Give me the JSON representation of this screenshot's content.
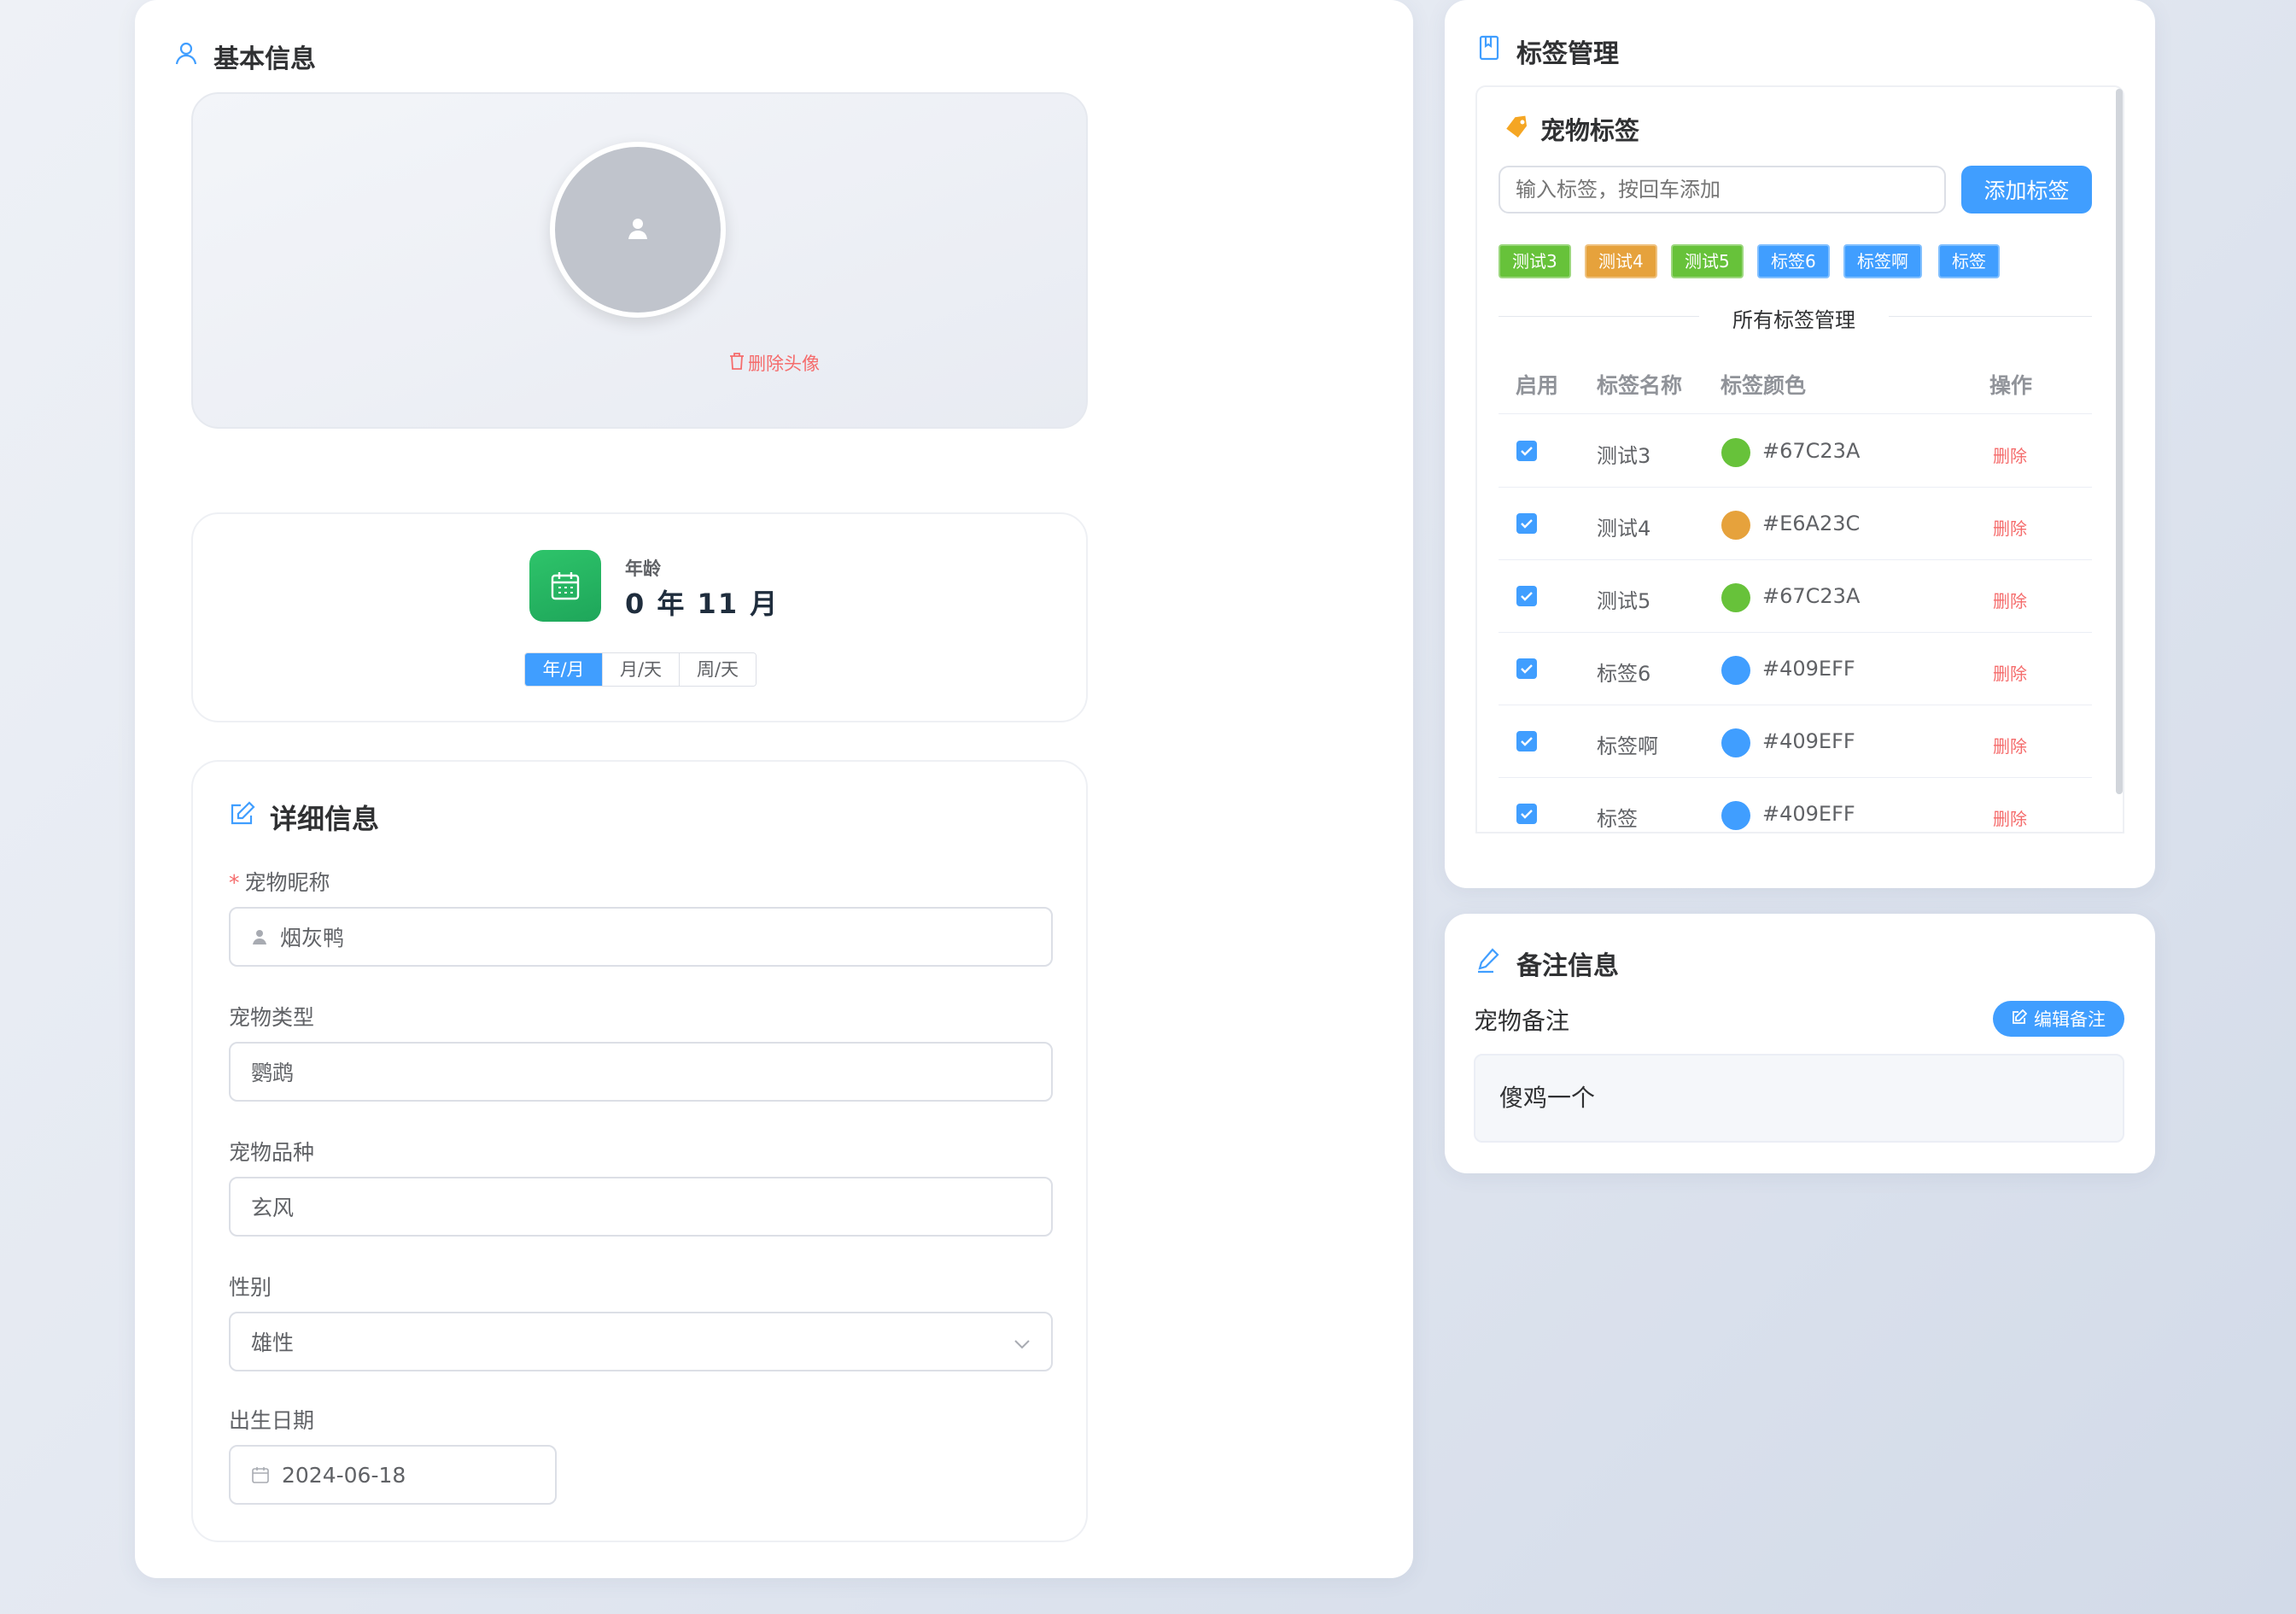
{
  "basic_info": {
    "title": "基本信息",
    "delete_avatar": "删除头像",
    "age": {
      "label": "年龄",
      "value": "0 年 11 月",
      "units": [
        "年/月",
        "月/天",
        "周/天"
      ],
      "selected": "年/月"
    }
  },
  "details": {
    "title": "详细信息",
    "nickname": {
      "label": "宠物昵称",
      "value": "烟灰鸭",
      "required": true
    },
    "type": {
      "label": "宠物类型",
      "value": "鹦鹉"
    },
    "breed": {
      "label": "宠物品种",
      "value": "玄风"
    },
    "gender": {
      "label": "性别",
      "value": "雄性"
    },
    "birthday": {
      "label": "出生日期",
      "value": "2024-06-18"
    }
  },
  "tags": {
    "title": "标签管理",
    "pet_tags_title": "宠物标签",
    "input_placeholder": "输入标签，按回车添加",
    "add_button": "添加标签",
    "chips": [
      {
        "label": "测试3",
        "color": "#67C23A"
      },
      {
        "label": "测试4",
        "color": "#E6A23C"
      },
      {
        "label": "测试5",
        "color": "#67C23A"
      },
      {
        "label": "标签6",
        "color": "#409EFF"
      },
      {
        "label": "标签啊",
        "color": "#409EFF"
      },
      {
        "label": "标签",
        "color": "#409EFF"
      }
    ],
    "all_tags_title": "所有标签管理",
    "columns": [
      "启用",
      "标签名称",
      "标签颜色",
      "操作"
    ],
    "rows": [
      {
        "name": "测试3",
        "color": "#67C23A",
        "enabled": true,
        "action": "删除"
      },
      {
        "name": "测试4",
        "color": "#E6A23C",
        "enabled": true,
        "action": "删除"
      },
      {
        "name": "测试5",
        "color": "#67C23A",
        "enabled": true,
        "action": "删除"
      },
      {
        "name": "标签6",
        "color": "#409EFF",
        "enabled": true,
        "action": "删除"
      },
      {
        "name": "标签啊",
        "color": "#409EFF",
        "enabled": true,
        "action": "删除"
      },
      {
        "name": "标签",
        "color": "#409EFF",
        "enabled": true,
        "action": "删除"
      }
    ]
  },
  "notes": {
    "title": "备注信息",
    "subtitle": "宠物备注",
    "edit_button": "编辑备注",
    "content": "傻鸡一个"
  },
  "colors": {
    "primary": "#409EFF",
    "danger": "#F56C6C",
    "success": "#67C23A",
    "warning": "#E6A23C"
  }
}
